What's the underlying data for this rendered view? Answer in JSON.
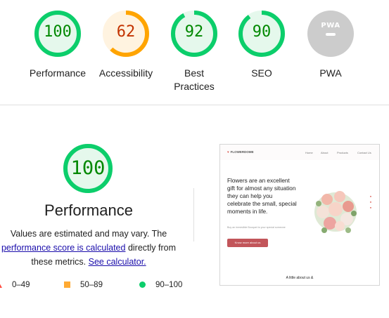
{
  "scores": [
    {
      "label": "Performance",
      "value": "100",
      "fraction": 1.0,
      "status": "pass"
    },
    {
      "label": "Accessibility",
      "value": "62",
      "fraction": 0.62,
      "status": "average"
    },
    {
      "label": "Best Practices",
      "value": "92",
      "fraction": 0.92,
      "status": "pass"
    },
    {
      "label": "SEO",
      "value": "90",
      "fraction": 0.9,
      "status": "pass"
    },
    {
      "label": "PWA",
      "value": "",
      "badge_text": "PWA",
      "status": "na"
    }
  ],
  "colors": {
    "pass_stroke": "#0cce6b",
    "pass_fill": "#e5f8ec",
    "pass_text": "#008800",
    "avg_stroke": "#ffa400",
    "avg_fill": "#fff3e0",
    "avg_text": "#c33300",
    "fail": "#ff4e42",
    "na": "#cccccc"
  },
  "performance": {
    "score": "100",
    "fraction": 1.0,
    "title": "Performance",
    "desc_1": "Values are estimated and may vary. The",
    "link_score": "performance score is calculated",
    "desc_2": "directly from these metrics.",
    "link_calc": "See calculator."
  },
  "legend": [
    {
      "range": "0–49",
      "shape": "triangle"
    },
    {
      "range": "50–89",
      "shape": "square"
    },
    {
      "range": "90–100",
      "shape": "circle"
    }
  ],
  "screenshot": {
    "logo": "FLOWERDOME",
    "nav": [
      "Home",
      "About",
      "Products",
      "Contact Us"
    ],
    "headline": "Flowers are an excellent gift for almost any situation they can help you celebrate the small, special moments in life.",
    "subtext": "Buy an irresistible Bouquet to your special someone",
    "cta": "Know more about us",
    "about": "A little about us &"
  }
}
